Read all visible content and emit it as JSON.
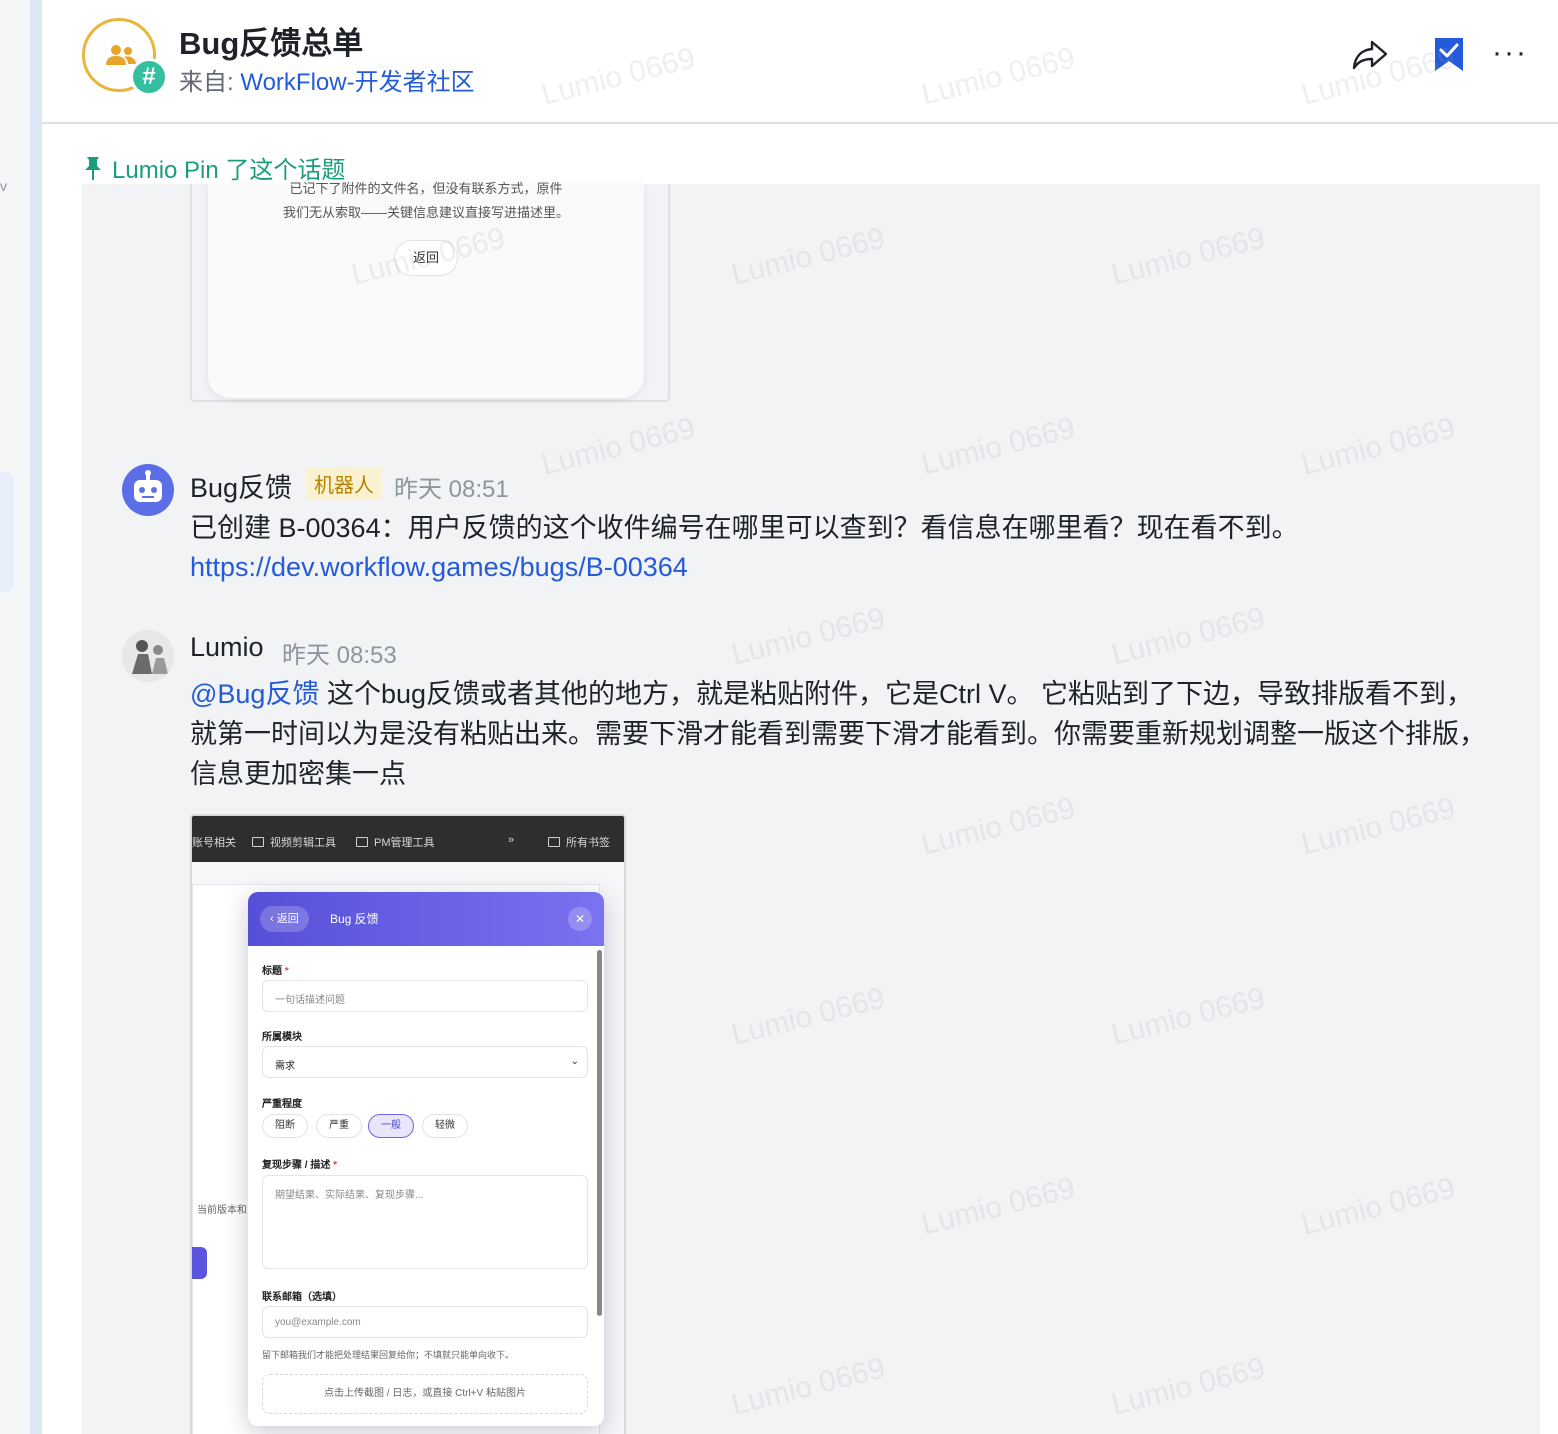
{
  "header": {
    "title": "Bug反馈总单",
    "source_prefix": "来自: ",
    "source_link": "WorkFlow-开发者社区",
    "hash_badge": "#",
    "more_label": "···"
  },
  "left_rail": {
    "letter": "v"
  },
  "pin_bar": {
    "text": "Lumio Pin 了这个话题"
  },
  "prev_attachment": {
    "line1": "已记下了附件的文件名，但没有联系方式，原件",
    "line2": "我们无从索取——关键信息建议直接写进描述里。",
    "back_button": "返回"
  },
  "messages": [
    {
      "sender": "Bug反馈",
      "tag": "机器人",
      "time": "昨天 08:51",
      "text": "已创建 B-00364：用户反馈的这个收件编号在哪里可以查到？看信息在哪里看？现在看不到。",
      "link": "https://dev.workflow.games/bugs/B-00364"
    },
    {
      "sender": "Lumio",
      "time": "昨天 08:53",
      "mention": "@Bug反馈",
      "text": " 这个bug反馈或者其他的地方，就是粘贴附件，它是Ctrl V。 它粘贴到了下边，导致排版看不到，就第一时间以为是没有粘贴出来。需要下滑才能看到需要下滑才能看到。你需要重新规划调整一版这个排版，信息更加密集一点"
    }
  ],
  "screenshot": {
    "bookmarks": [
      "账号相关",
      "视频剪辑工具",
      "PM管理工具",
      "»",
      "所有书签"
    ],
    "bg_side_text": "当前版本和",
    "modal": {
      "back": "‹ 返回",
      "title": "Bug 反馈",
      "close": "✕",
      "title_label": "标题",
      "required_mark": "*",
      "title_placeholder": "一句话描述问题",
      "module_label": "所属模块",
      "module_value": "需求",
      "severity_label": "严重程度",
      "severity_options": [
        "阻断",
        "严重",
        "一般",
        "轻微"
      ],
      "severity_selected": "一般",
      "steps_label": "复现步骤 / 描述",
      "steps_placeholder": "期望结果、实际结果、复现步骤...",
      "email_label": "联系邮箱（选填）",
      "email_placeholder": "you@example.com",
      "email_hint": "留下邮箱我们才能把处理结果回复给你；不填就只能单向收下。",
      "upload_text": "点击上传截图 / 日志，或直接 Ctrl+V 粘贴图片"
    }
  },
  "watermark": "Lumio 0669",
  "colors": {
    "accent_link": "#245bdb",
    "pin_green": "#1a9d7f",
    "bot_tag_bg": "#faf1d1",
    "bot_tag_text": "#b88200",
    "modal_header": "#5650d8",
    "bookmark_blue": "#245bdb"
  }
}
